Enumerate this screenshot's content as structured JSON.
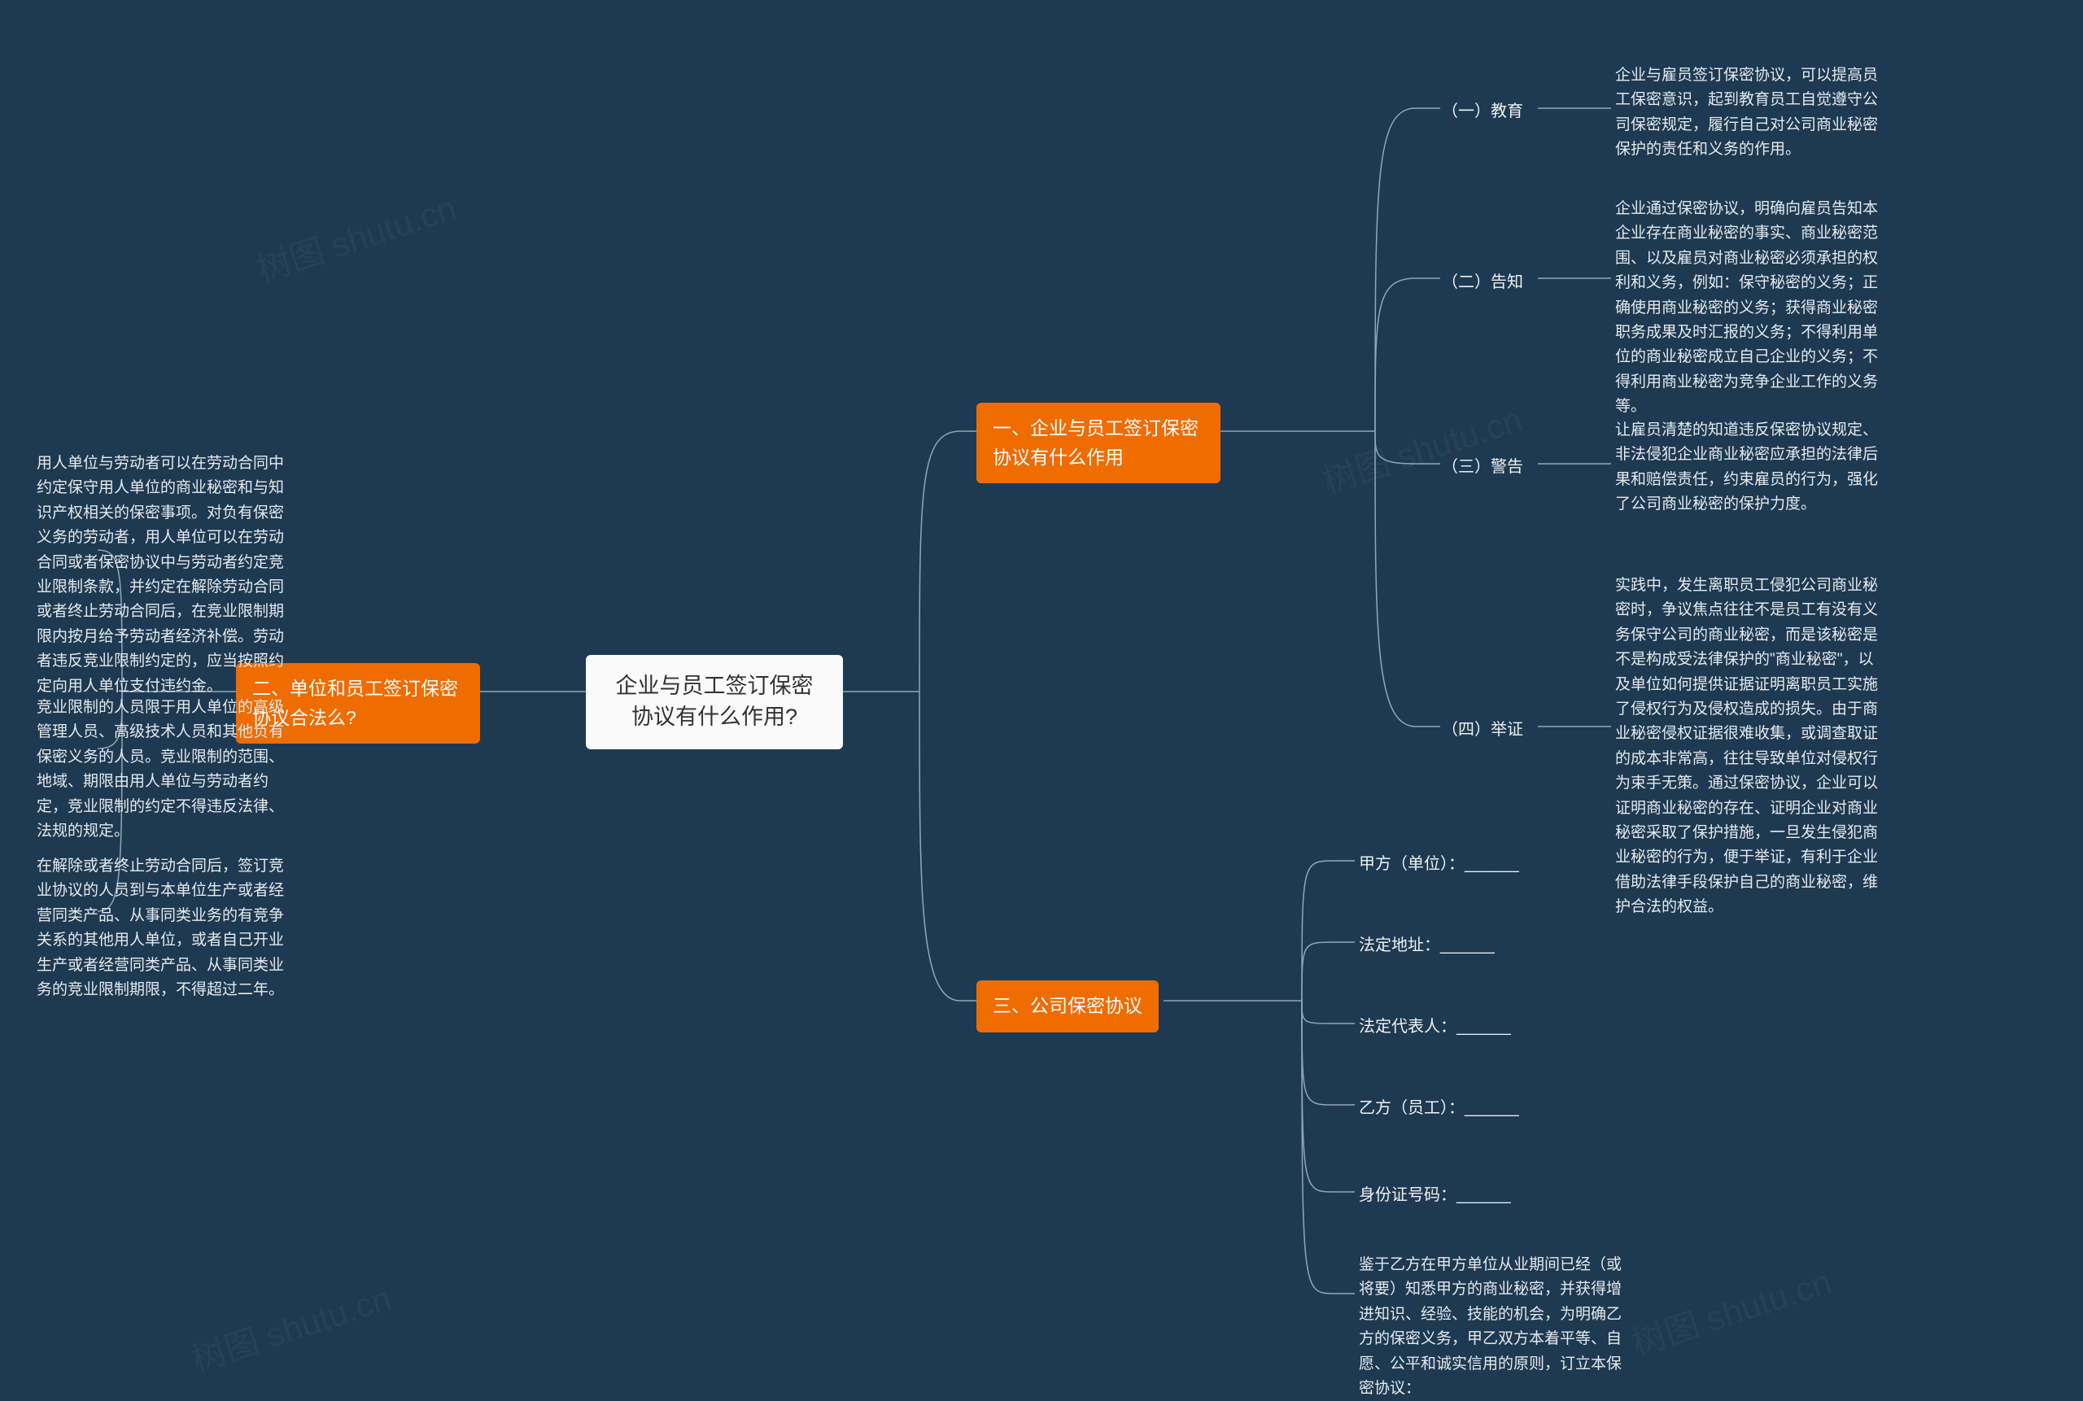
{
  "root": "企业与员工签订保密协议有什么作用?",
  "branches": {
    "b1": {
      "title": "一、企业与员工签订保密协议有什么作用",
      "children": [
        {
          "label": "（一）教育",
          "body": "企业与雇员签订保密协议，可以提高员工保密意识，起到教育员工自觉遵守公司保密规定，履行自己对公司商业秘密保护的责任和义务的作用。"
        },
        {
          "label": "（二）告知",
          "body": "企业通过保密协议，明确向雇员告知本企业存在商业秘密的事实、商业秘密范围、以及雇员对商业秘密必须承担的权利和义务，例如：保守秘密的义务；正确使用商业秘密的义务；获得商业秘密职务成果及时汇报的义务；不得利用单位的商业秘密成立自己企业的义务；不得利用商业秘密为竞争企业工作的义务等。"
        },
        {
          "label": "（三）警告",
          "body": "让雇员清楚的知道违反保密协议规定、非法侵犯企业商业秘密应承担的法律后果和赔偿责任，约束雇员的行为，强化了公司商业秘密的保护力度。"
        },
        {
          "label": "（四）举证",
          "body": "实践中，发生离职员工侵犯公司商业秘密时，争议焦点往往不是员工有没有义务保守公司的商业秘密，而是该秘密是不是构成受法律保护的\"商业秘密\"，以及单位如何提供证据证明离职员工实施了侵权行为及侵权造成的损失。由于商业秘密侵权证据很难收集，或调查取证的成本非常高，往往导致单位对侵权行为束手无策。通过保密协议，企业可以证明商业秘密的存在、证明企业对商业秘密采取了保护措施，一旦发生侵犯商业秘密的行为，便于举证，有利于企业借助法律手段保护自己的商业秘密，维护合法的权益。"
        }
      ]
    },
    "b2": {
      "title": "二、单位和员工签订保密协议合法么?",
      "children": [
        {
          "body": "用人单位与劳动者可以在劳动合同中约定保守用人单位的商业秘密和与知识产权相关的保密事项。对负有保密义务的劳动者，用人单位可以在劳动合同或者保密协议中与劳动者约定竞业限制条款，并约定在解除劳动合同或者终止劳动合同后，在竞业限制期限内按月给予劳动者经济补偿。劳动者违反竞业限制约定的，应当按照约定向用人单位支付违约金。"
        },
        {
          "body": "竞业限制的人员限于用人单位的高级管理人员、高级技术人员和其他负有保密义务的人员。竞业限制的范围、地域、期限由用人单位与劳动者约定，竞业限制的约定不得违反法律、法规的规定。"
        },
        {
          "body": "在解除或者终止劳动合同后，签订竞业协议的人员到与本单位生产或者经营同类产品、从事同类业务的有竞争关系的其他用人单位，或者自己开业生产或者经营同类产品、从事同类业务的竞业限制期限，不得超过二年。"
        }
      ]
    },
    "b3": {
      "title": "三、公司保密协议",
      "children": [
        {
          "body": "甲方（单位）：______"
        },
        {
          "body": "法定地址：______"
        },
        {
          "body": "法定代表人：______"
        },
        {
          "body": "乙方（员工）：______"
        },
        {
          "body": "身份证号码：______"
        },
        {
          "body": "鉴于乙方在甲方单位从业期间已经（或将要）知悉甲方的商业秘密，并获得增进知识、经验、技能的机会，为明确乙方的保密义务，甲乙双方本着平等、自愿、公平和诚实信用的原则，订立本保密协议："
        }
      ]
    }
  },
  "watermark": "树图 shutu.cn"
}
